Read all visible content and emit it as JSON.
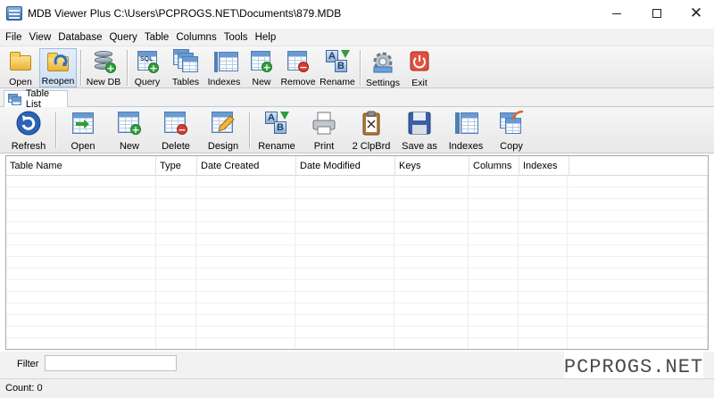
{
  "window": {
    "title": "MDB Viewer Plus C:\\Users\\PCPROGS.NET\\Documents\\879.MDB",
    "minimize_label": "—",
    "close_label": "✕"
  },
  "menu": [
    "File",
    "View",
    "Database",
    "Query",
    "Table",
    "Columns",
    "Tools",
    "Help"
  ],
  "toolbar": {
    "open": "Open",
    "reopen": "Reopen",
    "new_db": "New DB",
    "query": "Query",
    "tables": "Tables",
    "indexes": "Indexes",
    "new": "New",
    "remove": "Remove",
    "rename": "Rename",
    "settings": "Settings",
    "exit": "Exit"
  },
  "tab": {
    "label": "Table List"
  },
  "table_toolbar": {
    "refresh": "Refresh",
    "open": "Open",
    "new": "New",
    "delete": "Delete",
    "design": "Design",
    "rename": "Rename",
    "print": "Print",
    "clipboard": "2 ClpBrd",
    "save_as": "Save as",
    "indexes": "Indexes",
    "copy": "Copy"
  },
  "grid": {
    "columns": [
      "Table Name",
      "Type",
      "Date Created",
      "Date Modified",
      "Keys",
      "Columns",
      "Indexes"
    ],
    "rows": []
  },
  "filter": {
    "label": "Filter",
    "value": ""
  },
  "status": {
    "text": "Count: 0"
  },
  "watermark": {
    "text": "PCPROGS.NET"
  }
}
